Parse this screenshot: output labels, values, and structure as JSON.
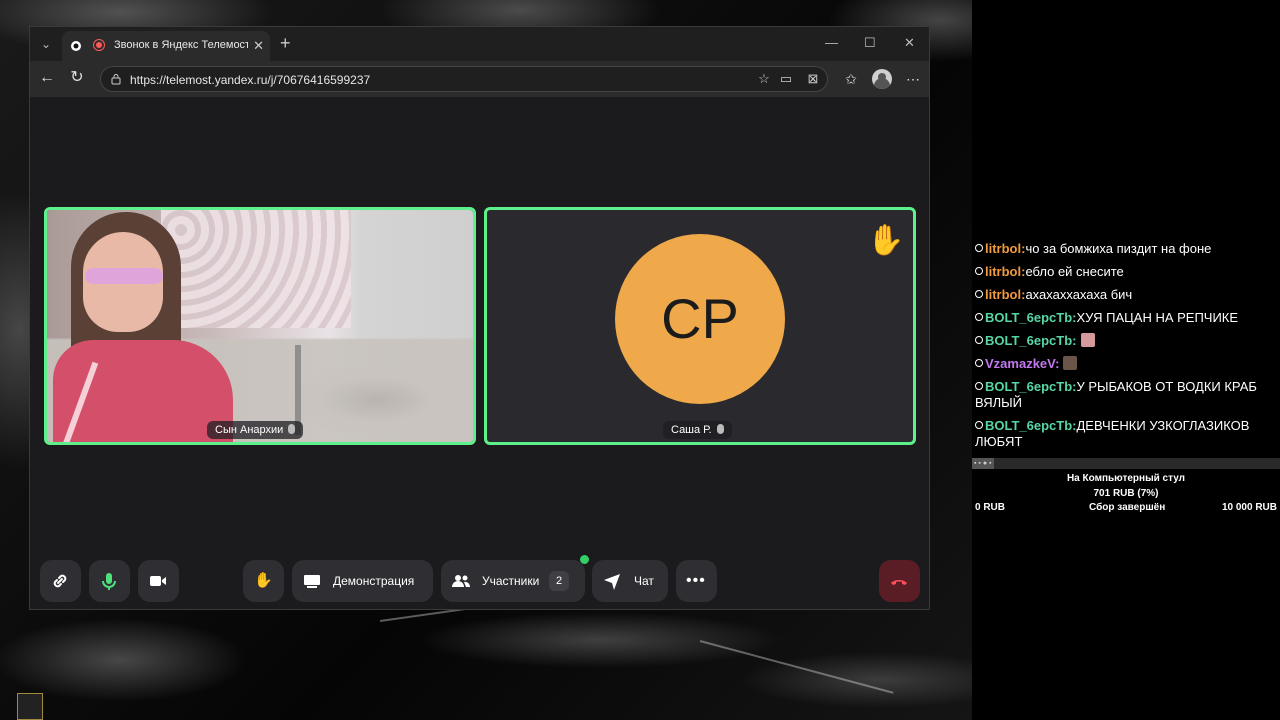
{
  "browser": {
    "tab_title": "Звонок в Яндекс Телемосте",
    "tab_close": "✕",
    "new_tab": "+",
    "url": "https://telemost.yandex.ru/j/70676416599237",
    "window_controls": {
      "minimize": "—",
      "maximize": "☐",
      "close": "✕"
    }
  },
  "call": {
    "participants": [
      {
        "name": "Сын Анархии",
        "type": "video"
      },
      {
        "name": "Саша Р.",
        "type": "avatar",
        "initials": "СР",
        "avatar_color": "#efa94a",
        "hand_raised": true
      }
    ],
    "speaking_border_color": "#5ef08a",
    "controls": {
      "link_icon": "link-icon",
      "mic_icon": "microphone-icon",
      "camera_icon": "camera-icon",
      "raise_hand_icon": "hand-icon",
      "screen_share_label": "Демонстрация",
      "participants_label": "Участники",
      "participants_count": "2",
      "chat_label": "Чат",
      "more_icon": "more-icon",
      "hangup_icon": "hangup-icon"
    }
  },
  "chat": {
    "messages": [
      {
        "nick": "litrbol:",
        "nick_color": "#ef9a3c",
        "text": "чо за бомжиха пиздит на фоне"
      },
      {
        "nick": "litrbol:",
        "nick_color": "#ef9a3c",
        "text": "ебло ей снесите"
      },
      {
        "nick": "litrbol:",
        "nick_color": "#ef9a3c",
        "text": "ахахаххахаха бич"
      },
      {
        "nick": "BOLT_6ерсТb:",
        "nick_color": "#58d6a4",
        "text": "ХУЯ ПАЦАН НА РЕПЧИКЕ"
      },
      {
        "nick": "BOLT_6ерсТb:",
        "nick_color": "#58d6a4",
        "text": "",
        "emote": true
      },
      {
        "nick": "VzamazkeV:",
        "nick_color": "#c478f0",
        "text": "",
        "emote": true
      },
      {
        "nick": "BOLT_6ерсТb:",
        "nick_color": "#58d6a4",
        "text": "У РЫБАКОВ ОТ ВОДКИ КРАБ ВЯЛЫЙ"
      },
      {
        "nick": "BOLT_6ерсТb:",
        "nick_color": "#58d6a4",
        "text": "ДЕВЧЕНКИ УЗКОГЛАЗИКОВ ЛЮБЯТ"
      }
    ]
  },
  "donation_goal": {
    "title": "На Компьютерный стул",
    "amount": "701 RUB (7%)",
    "progress_fraction": 0.07,
    "min": "0 RUB",
    "status": "Сбор завершён",
    "max": "10 000 RUB"
  }
}
